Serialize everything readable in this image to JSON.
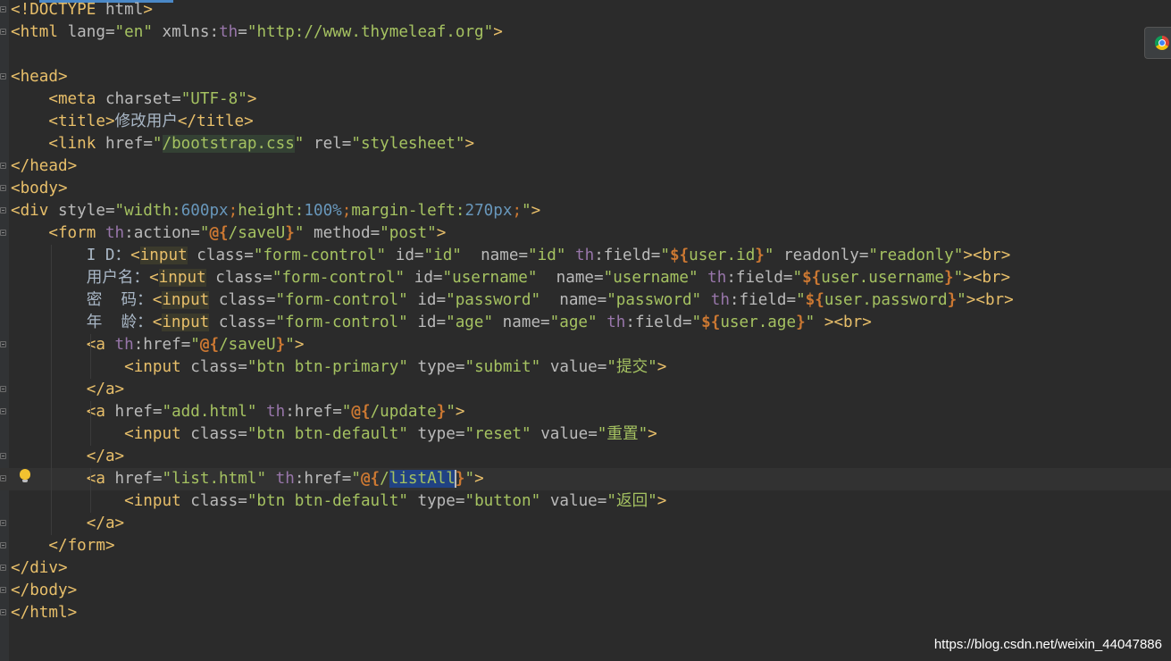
{
  "editor": {
    "language": "html",
    "highlighted_line": 22,
    "lines": [
      "<!DOCTYPE html>",
      "<html lang=\"en\" xmlns:th=\"http://www.thymeleaf.org\">",
      "",
      "<head>",
      "    <meta charset=\"UTF-8\">",
      "    <title>修改用户</title>",
      "    <link href=\"/bootstrap.css\" rel=\"stylesheet\">",
      "</head>",
      "<body>",
      "<div style=\"width:600px;height:100%;margin-left:270px;\">",
      "    <form th:action=\"@{/saveU}\" method=\"post\">",
      "        I D：<input class=\"form-control\" id=\"id\"  name=\"id\" th:field=\"${user.id}\" readonly=\"readonly\"><br>",
      "        用户名：<input class=\"form-control\" id=\"username\"  name=\"username\" th:field=\"${user.username}\"><br>",
      "        密  码：<input class=\"form-control\" id=\"password\"  name=\"password\" th:field=\"${user.password}\"><br>",
      "        年  龄：<input class=\"form-control\" id=\"age\" name=\"age\" th:field=\"${user.age}\" ><br>",
      "        <a th:href=\"@{/saveU}\">",
      "            <input class=\"btn btn-primary\" type=\"submit\" value=\"提交\">",
      "        </a>",
      "        <a href=\"add.html\" th:href=\"@{/update}\">",
      "            <input class=\"btn btn-default\" type=\"reset\" value=\"重置\">",
      "        </a>",
      "        <a href=\"list.html\" th:href=\"@{/listAll}\">",
      "            <input class=\"btn btn-default\" type=\"button\" value=\"返回\">",
      "        </a>",
      "    </form>",
      "</div>",
      "</body>",
      "</html>"
    ]
  },
  "icons": {
    "intention_bulb": "lightbulb-icon",
    "browser_popup": "chrome-icon"
  },
  "colors": {
    "background": "#2b2b2b",
    "tag": "#e8bf6a",
    "attribute": "#bababa",
    "string": "#a5c261",
    "namespace": "#9876aa",
    "expression": "#cc7832",
    "number": "#6897bb",
    "selection": "#214283"
  },
  "watermark": "https://blog.csdn.net/weixin_44047886"
}
